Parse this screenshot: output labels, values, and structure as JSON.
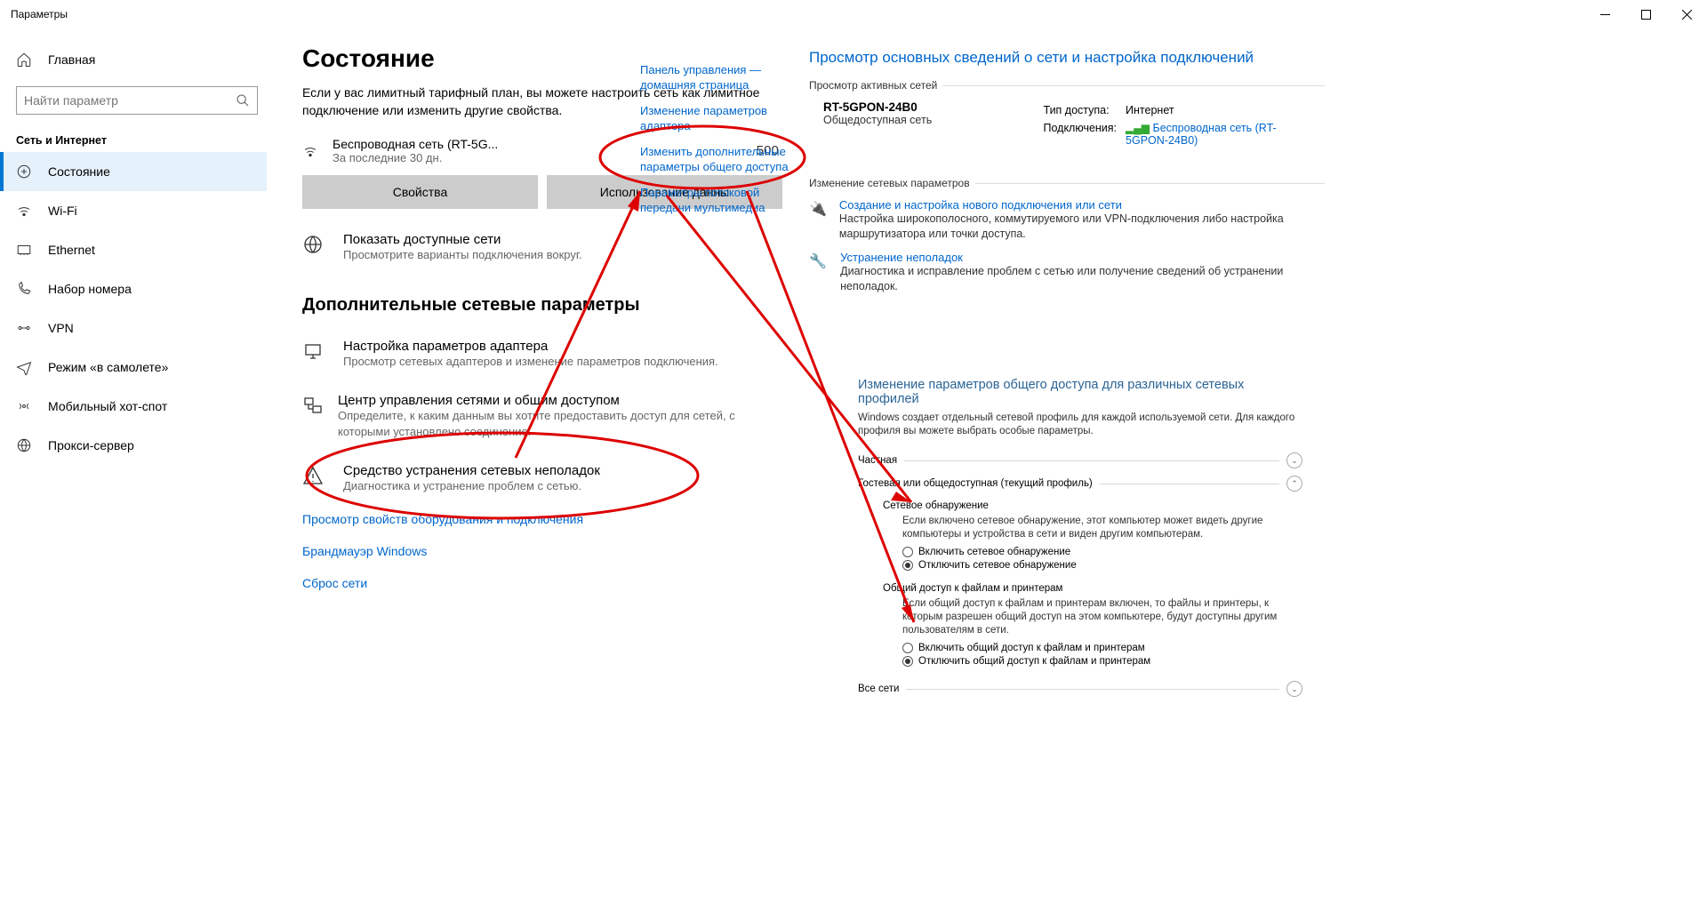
{
  "window": {
    "title": "Параметры"
  },
  "sidebar": {
    "home": "Главная",
    "search_placeholder": "Найти параметр",
    "section": "Сеть и Интернет",
    "items": [
      {
        "label": "Состояние"
      },
      {
        "label": "Wi-Fi"
      },
      {
        "label": "Ethernet"
      },
      {
        "label": "Набор номера"
      },
      {
        "label": "VPN"
      },
      {
        "label": "Режим «в самолете»"
      },
      {
        "label": "Мобильный хот-спот"
      },
      {
        "label": "Прокси-сервер"
      }
    ]
  },
  "main": {
    "heading": "Состояние",
    "metered_text": "Если у вас лимитный тарифный план, вы можете настроить сеть как лимитное подключение или изменить другие свойства.",
    "wifi_name": "Беспроводная сеть (RT-5G...",
    "wifi_period": "За последние 30 дн.",
    "wifi_usage": "500.",
    "btn_properties": "Свойства",
    "btn_usage": "Использование данны",
    "available_title": "Показать доступные сети",
    "available_sub": "Просмотрите варианты подключения вокруг.",
    "advanced_heading": "Дополнительные сетевые параметры",
    "adapter_title": "Настройка параметров адаптера",
    "adapter_sub": "Просмотр сетевых адаптеров и изменение параметров подключения.",
    "center_title": "Центр управления сетями и общим доступом",
    "center_sub": "Определите, к каким данным вы хотите предоставить доступ для сетей, с которыми установлено соединение.",
    "trouble_title": "Средство устранения сетевых неполадок",
    "trouble_sub": "Диагностика и устранение проблем с сетью.",
    "link_hw": "Просмотр свойств оборудования и подключения",
    "link_fw": "Брандмауэр Windows",
    "link_reset": "Сброс сети"
  },
  "cp_links": {
    "home": "Панель управления — домашняя страница",
    "adapter": "Изменение параметров адаптера",
    "sharing": "Изменить дополнительные параметры общего доступа",
    "streaming": "Параметры потоковой передачи мультимедиа"
  },
  "netcenter": {
    "title": "Просмотр основных сведений о сети и настройка подключений",
    "active_label": "Просмотр активных сетей",
    "net_name": "RT-5GPON-24B0",
    "net_type": "Общедоступная сеть",
    "access_label": "Тип доступа:",
    "access_value": "Интернет",
    "conn_label": "Подключения:",
    "conn_value": "Беспроводная сеть (RT-5GPON-24B0)",
    "change_label": "Изменение сетевых параметров",
    "new_conn_title": "Создание и настройка нового подключения или сети",
    "new_conn_sub": "Настройка широкополосного, коммутируемого или VPN-подключения либо настройка маршрутизатора или точки доступа.",
    "troubleshoot_title": "Устранение неполадок",
    "troubleshoot_sub": "Диагностика и исправление проблем с сетью или получение сведений об устранении неполадок."
  },
  "sharing": {
    "title": "Изменение параметров общего доступа для различных сетевых профилей",
    "subtext": "Windows создает отдельный сетевой профиль для каждой используемой сети. Для каждого профиля вы можете выбрать особые параметры.",
    "profile_private": "Частная",
    "profile_guest": "Гостевая или общедоступная (текущий профиль)",
    "profile_all": "Все сети",
    "discovery_head": "Сетевое обнаружение",
    "discovery_desc": "Если включено сетевое обнаружение, этот компьютер может видеть другие компьютеры и устройства в сети и виден другим компьютерам.",
    "discovery_on": "Включить сетевое обнаружение",
    "discovery_off": "Отключить сетевое обнаружение",
    "fileshare_head": "Общий доступ к файлам и принтерам",
    "fileshare_desc": "Если общий доступ к файлам и принтерам включен, то файлы и принтеры, к которым разрешен общий доступ на этом компьютере, будут доступны другим пользователям в сети.",
    "fileshare_on": "Включить общий доступ к файлам и принтерам",
    "fileshare_off": "Отключить общий доступ к файлам и принтерам"
  }
}
